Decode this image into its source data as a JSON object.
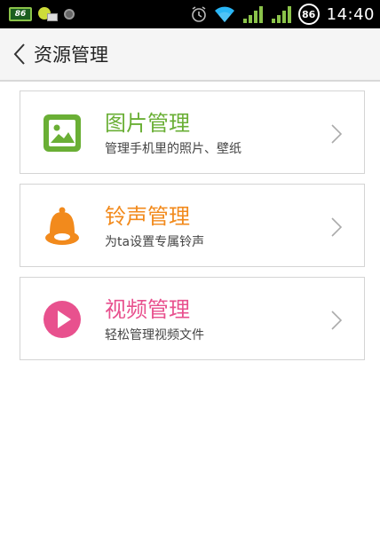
{
  "status_bar": {
    "battery_label": "86",
    "badge_label": "86",
    "time": "14:40",
    "icons": [
      "battery-icon",
      "bean-notify-icon",
      "record-dot-icon",
      "alarm-icon",
      "wifi-icon",
      "signal-icon",
      "signal-icon"
    ]
  },
  "header": {
    "title": "资源管理",
    "back_icon": "chevron-left-icon"
  },
  "items": [
    {
      "title": "图片管理",
      "desc": "管理手机里的照片、壁纸",
      "icon": "picture-icon",
      "color": "#6aaf35"
    },
    {
      "title": "铃声管理",
      "desc": "为ta设置专属铃声",
      "icon": "bell-icon",
      "color": "#f28a1c"
    },
    {
      "title": "视频管理",
      "desc": "轻松管理视频文件",
      "icon": "play-video-icon",
      "color": "#e8518e"
    }
  ]
}
